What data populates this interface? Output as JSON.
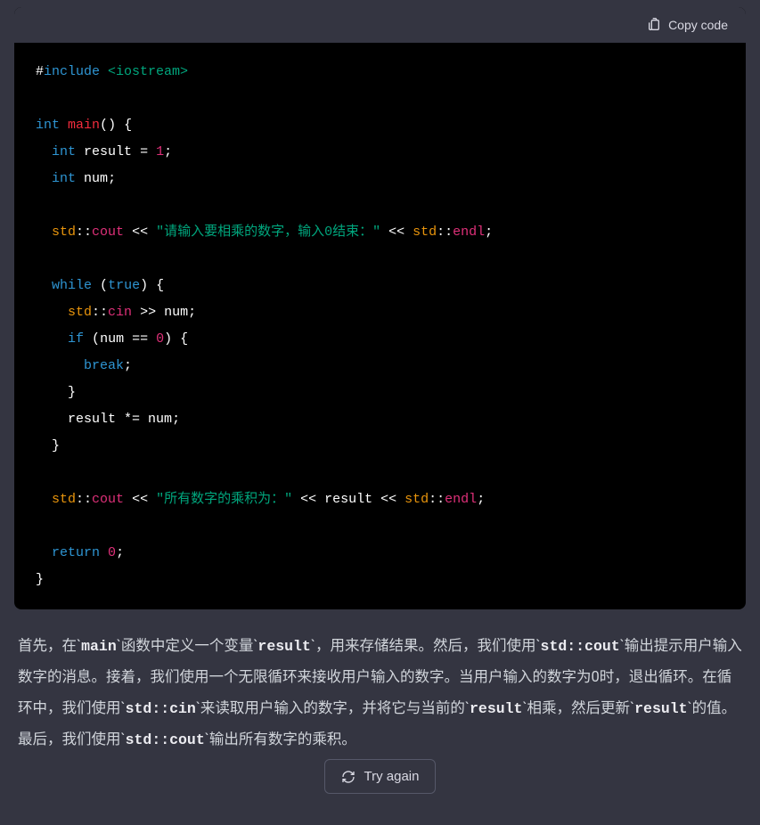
{
  "toolbar": {
    "copy_label": "Copy code"
  },
  "code": {
    "include_hash": "#",
    "include_kw": "include",
    "include_path": "<iostream>",
    "int_kw": "int",
    "main_fn": "main",
    "paren_open": "(",
    "paren_close": ")",
    "brace_open": "{",
    "brace_close": "}",
    "result_decl_ident": "result",
    "eq": " = ",
    "one": "1",
    "semi": ";",
    "num_ident": "num",
    "std_ns": "std",
    "scope": "::",
    "cout": "cout",
    "cin": "cin",
    "endl": "endl",
    "out_op": " << ",
    "in_op": " >> ",
    "prompt_string": "\"请输入要相乘的数字，输入0结束：\"",
    "while_kw": "while",
    "true_kw": "true",
    "if_kw": "if",
    "eq_op": " == ",
    "zero": "0",
    "break_kw": "break",
    "mul_assign": " *= ",
    "result_string": "\"所有数字的乘积为：\"",
    "result_ident": "result",
    "return_kw": "return"
  },
  "explanation": {
    "t1": "首先，在`",
    "c1": "main",
    "t2": "`函数中定义一个变量`",
    "c2": "result",
    "t3": "`，用来存储结果。然后，我们使用`",
    "c3": "std::cout",
    "t4": "`输出提示用户输入数字的消息。接着，我们使用一个无限循环来接收用户输入的数字。当用户输入的数字为0时，退出循环。在循环中，我们使用`",
    "c4": "std::cin",
    "t5": "`来读取用户输入的数字，并将它与当前的`",
    "c5": "result",
    "t6": "`相乘，然后更新`",
    "c6": "result",
    "t7": "`的值。最后，我们使用`",
    "c7": "std::cout",
    "t8": "`输出所有数字的乘积。"
  },
  "footer": {
    "try_again_label": "Try again"
  }
}
